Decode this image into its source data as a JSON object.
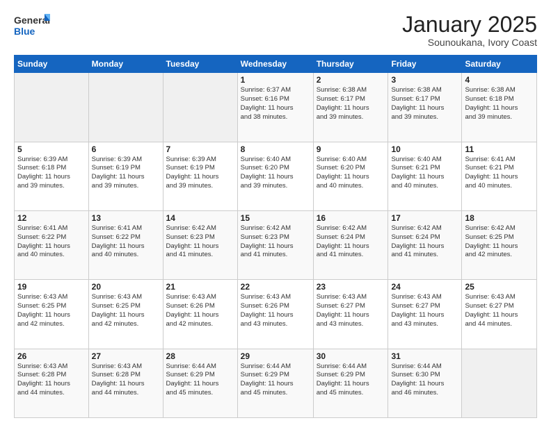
{
  "logo": {
    "general": "General",
    "blue": "Blue"
  },
  "header": {
    "month": "January 2025",
    "location": "Sounoukana, Ivory Coast"
  },
  "weekdays": [
    "Sunday",
    "Monday",
    "Tuesday",
    "Wednesday",
    "Thursday",
    "Friday",
    "Saturday"
  ],
  "weeks": [
    [
      {
        "day": "",
        "info": ""
      },
      {
        "day": "",
        "info": ""
      },
      {
        "day": "",
        "info": ""
      },
      {
        "day": "1",
        "info": "Sunrise: 6:37 AM\nSunset: 6:16 PM\nDaylight: 11 hours\nand 38 minutes."
      },
      {
        "day": "2",
        "info": "Sunrise: 6:38 AM\nSunset: 6:17 PM\nDaylight: 11 hours\nand 39 minutes."
      },
      {
        "day": "3",
        "info": "Sunrise: 6:38 AM\nSunset: 6:17 PM\nDaylight: 11 hours\nand 39 minutes."
      },
      {
        "day": "4",
        "info": "Sunrise: 6:38 AM\nSunset: 6:18 PM\nDaylight: 11 hours\nand 39 minutes."
      }
    ],
    [
      {
        "day": "5",
        "info": "Sunrise: 6:39 AM\nSunset: 6:18 PM\nDaylight: 11 hours\nand 39 minutes."
      },
      {
        "day": "6",
        "info": "Sunrise: 6:39 AM\nSunset: 6:19 PM\nDaylight: 11 hours\nand 39 minutes."
      },
      {
        "day": "7",
        "info": "Sunrise: 6:39 AM\nSunset: 6:19 PM\nDaylight: 11 hours\nand 39 minutes."
      },
      {
        "day": "8",
        "info": "Sunrise: 6:40 AM\nSunset: 6:20 PM\nDaylight: 11 hours\nand 39 minutes."
      },
      {
        "day": "9",
        "info": "Sunrise: 6:40 AM\nSunset: 6:20 PM\nDaylight: 11 hours\nand 40 minutes."
      },
      {
        "day": "10",
        "info": "Sunrise: 6:40 AM\nSunset: 6:21 PM\nDaylight: 11 hours\nand 40 minutes."
      },
      {
        "day": "11",
        "info": "Sunrise: 6:41 AM\nSunset: 6:21 PM\nDaylight: 11 hours\nand 40 minutes."
      }
    ],
    [
      {
        "day": "12",
        "info": "Sunrise: 6:41 AM\nSunset: 6:22 PM\nDaylight: 11 hours\nand 40 minutes."
      },
      {
        "day": "13",
        "info": "Sunrise: 6:41 AM\nSunset: 6:22 PM\nDaylight: 11 hours\nand 40 minutes."
      },
      {
        "day": "14",
        "info": "Sunrise: 6:42 AM\nSunset: 6:23 PM\nDaylight: 11 hours\nand 41 minutes."
      },
      {
        "day": "15",
        "info": "Sunrise: 6:42 AM\nSunset: 6:23 PM\nDaylight: 11 hours\nand 41 minutes."
      },
      {
        "day": "16",
        "info": "Sunrise: 6:42 AM\nSunset: 6:24 PM\nDaylight: 11 hours\nand 41 minutes."
      },
      {
        "day": "17",
        "info": "Sunrise: 6:42 AM\nSunset: 6:24 PM\nDaylight: 11 hours\nand 41 minutes."
      },
      {
        "day": "18",
        "info": "Sunrise: 6:42 AM\nSunset: 6:25 PM\nDaylight: 11 hours\nand 42 minutes."
      }
    ],
    [
      {
        "day": "19",
        "info": "Sunrise: 6:43 AM\nSunset: 6:25 PM\nDaylight: 11 hours\nand 42 minutes."
      },
      {
        "day": "20",
        "info": "Sunrise: 6:43 AM\nSunset: 6:25 PM\nDaylight: 11 hours\nand 42 minutes."
      },
      {
        "day": "21",
        "info": "Sunrise: 6:43 AM\nSunset: 6:26 PM\nDaylight: 11 hours\nand 42 minutes."
      },
      {
        "day": "22",
        "info": "Sunrise: 6:43 AM\nSunset: 6:26 PM\nDaylight: 11 hours\nand 43 minutes."
      },
      {
        "day": "23",
        "info": "Sunrise: 6:43 AM\nSunset: 6:27 PM\nDaylight: 11 hours\nand 43 minutes."
      },
      {
        "day": "24",
        "info": "Sunrise: 6:43 AM\nSunset: 6:27 PM\nDaylight: 11 hours\nand 43 minutes."
      },
      {
        "day": "25",
        "info": "Sunrise: 6:43 AM\nSunset: 6:27 PM\nDaylight: 11 hours\nand 44 minutes."
      }
    ],
    [
      {
        "day": "26",
        "info": "Sunrise: 6:43 AM\nSunset: 6:28 PM\nDaylight: 11 hours\nand 44 minutes."
      },
      {
        "day": "27",
        "info": "Sunrise: 6:43 AM\nSunset: 6:28 PM\nDaylight: 11 hours\nand 44 minutes."
      },
      {
        "day": "28",
        "info": "Sunrise: 6:44 AM\nSunset: 6:29 PM\nDaylight: 11 hours\nand 45 minutes."
      },
      {
        "day": "29",
        "info": "Sunrise: 6:44 AM\nSunset: 6:29 PM\nDaylight: 11 hours\nand 45 minutes."
      },
      {
        "day": "30",
        "info": "Sunrise: 6:44 AM\nSunset: 6:29 PM\nDaylight: 11 hours\nand 45 minutes."
      },
      {
        "day": "31",
        "info": "Sunrise: 6:44 AM\nSunset: 6:30 PM\nDaylight: 11 hours\nand 46 minutes."
      },
      {
        "day": "",
        "info": ""
      }
    ]
  ]
}
